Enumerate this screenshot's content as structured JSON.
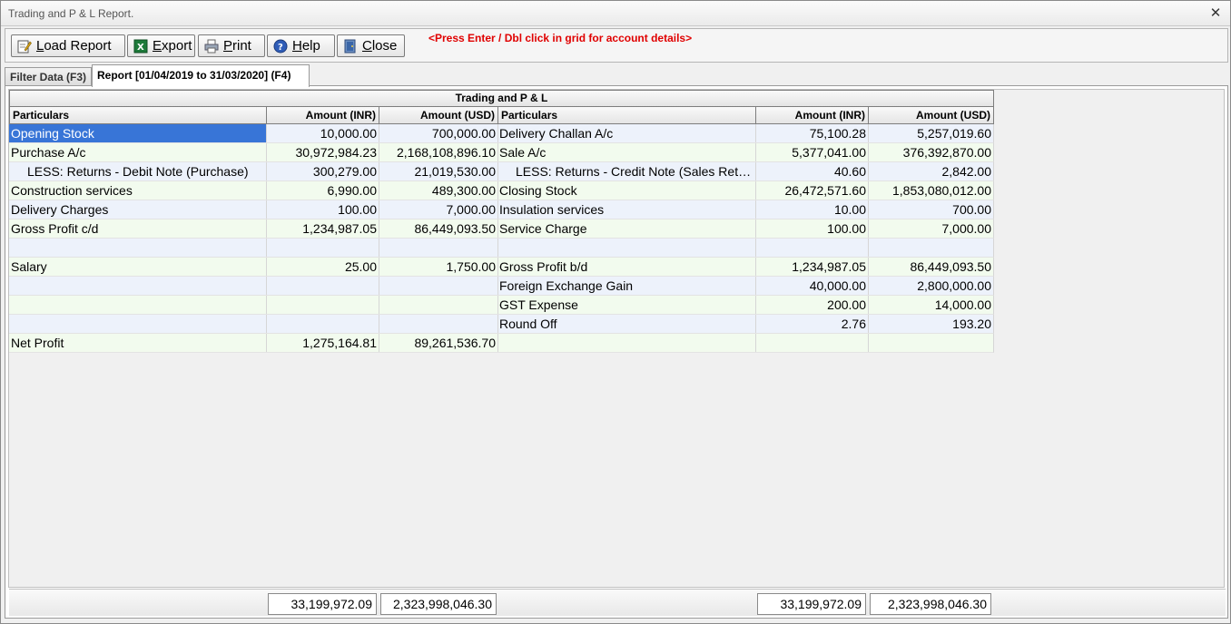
{
  "window": {
    "title": "Trading and P & L Report."
  },
  "toolbar": {
    "buttons": [
      {
        "label": "Load Report",
        "icon": "edit-icon"
      },
      {
        "label": "Export",
        "icon": "excel-icon"
      },
      {
        "label": "Print",
        "icon": "printer-icon"
      },
      {
        "label": "Help",
        "icon": "help-icon"
      },
      {
        "label": "Close",
        "icon": "door-icon"
      }
    ],
    "hint": "<Press Enter / Dbl click in grid for account details>"
  },
  "tabs": [
    {
      "label": "Filter Data (F3)",
      "active": false
    },
    {
      "label": "Report [01/04/2019 to 31/03/2020] (F4)",
      "active": true
    }
  ],
  "grid": {
    "caption": "Trading and P & L",
    "headers": [
      "Particulars",
      "Amount (INR)",
      "Amount (USD)",
      "Particulars",
      "Amount (INR)",
      "Amount (USD)"
    ],
    "rows": [
      [
        "Opening Stock",
        "10,000.00",
        "700,000.00",
        "Delivery Challan A/c",
        "75,100.28",
        "5,257,019.60"
      ],
      [
        "Purchase A/c",
        "30,972,984.23",
        "2,168,108,896.10",
        "Sale A/c",
        "5,377,041.00",
        "376,392,870.00"
      ],
      [
        "LESS: Returns - Debit Note (Purchase)",
        "300,279.00",
        "21,019,530.00",
        "LESS: Returns - Credit Note (Sales Returns)",
        "40.60",
        "2,842.00"
      ],
      [
        "Construction services",
        "6,990.00",
        "489,300.00",
        "Closing Stock",
        "26,472,571.60",
        "1,853,080,012.00"
      ],
      [
        "Delivery Charges",
        "100.00",
        "7,000.00",
        "Insulation services",
        "10.00",
        "700.00"
      ],
      [
        "Gross Profit c/d",
        "1,234,987.05",
        "86,449,093.50",
        "Service Charge",
        "100.00",
        "7,000.00"
      ],
      [
        "",
        "",
        "",
        "",
        "",
        ""
      ],
      [
        "Salary",
        "25.00",
        "1,750.00",
        "Gross Profit b/d",
        "1,234,987.05",
        "86,449,093.50"
      ],
      [
        "",
        "",
        "",
        "Foreign Exchange Gain",
        "40,000.00",
        "2,800,000.00"
      ],
      [
        "",
        "",
        "",
        "GST Expense",
        "200.00",
        "14,000.00"
      ],
      [
        "",
        "",
        "",
        "Round Off",
        "2.76",
        "193.20"
      ],
      [
        "Net Profit",
        "1,275,164.81",
        "89,261,536.70",
        "",
        "",
        ""
      ]
    ],
    "totals": [
      "33,199,972.09",
      "2,323,998,046.30",
      "33,199,972.09",
      "2,323,998,046.30"
    ]
  }
}
